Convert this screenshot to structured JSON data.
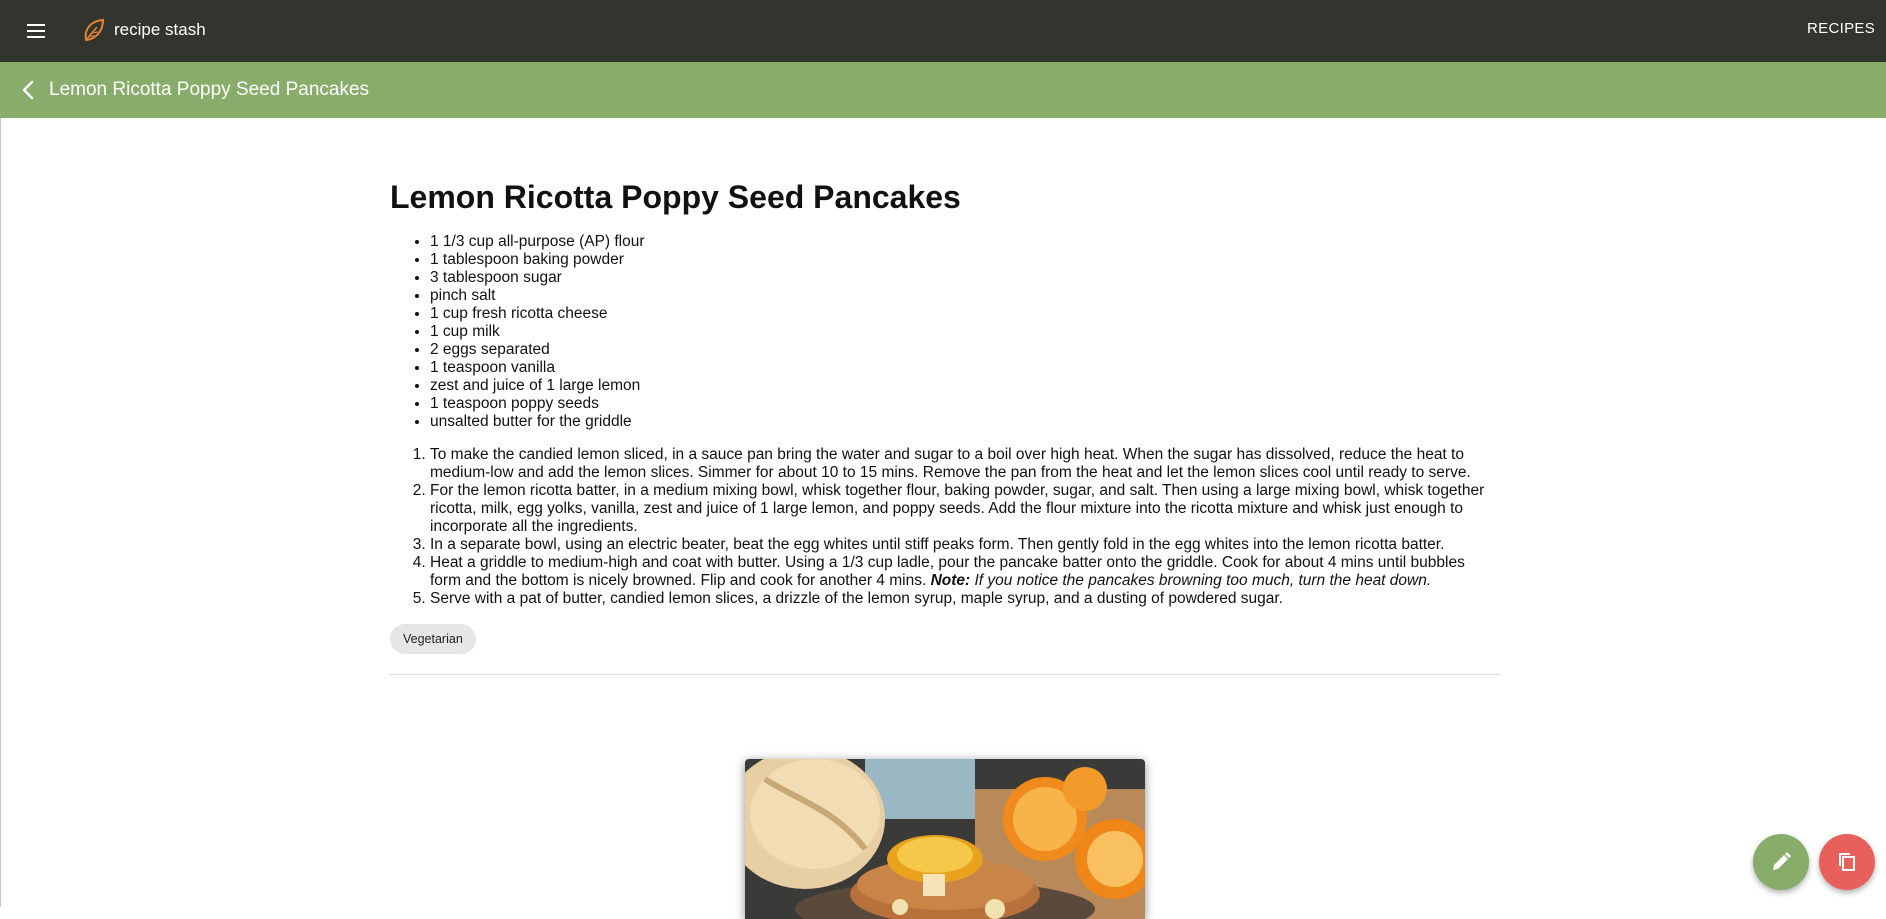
{
  "header": {
    "menu_icon": "hamburger-menu-icon",
    "logo_icon": "leaf-logo-icon",
    "brand": "recipe stash",
    "nav_link": "RECIPES"
  },
  "subheader": {
    "back_icon": "chevron-left-icon",
    "title": "Lemon Ricotta Poppy Seed Pancakes"
  },
  "recipe": {
    "title": "Lemon Ricotta Poppy Seed Pancakes",
    "ingredients": [
      "1 1/3 cup all-purpose (AP) flour",
      "1 tablespoon baking powder",
      "3 tablespoon sugar",
      "pinch salt",
      "1 cup fresh ricotta cheese",
      "1 cup milk",
      "2 eggs separated",
      "1 teaspoon vanilla",
      "zest and juice of 1 large lemon",
      "1 teaspoon poppy seeds",
      "unsalted butter for the griddle"
    ],
    "steps": [
      "To make the candied lemon sliced, in a sauce pan bring the water and sugar to a boil over high heat. When the sugar has dissolved, reduce the heat to medium-low and add the lemon slices. Simmer for about 10 to 15 mins. Remove the pan from the heat and let the lemon slices cool until ready to serve.",
      "For the lemon ricotta batter, in a medium mixing bowl, whisk together flour, baking powder, sugar, and salt. Then using a large mixing bowl, whisk together ricotta, milk, egg yolks, vanilla, zest and juice of 1 large lemon, and poppy seeds. Add the flour mixture into the ricotta mixture and whisk just enough to incorporate all the ingredients.",
      "In a separate bowl, using an electric beater, beat the egg whites until stiff peaks form. Then gently fold in the egg whites into the lemon ricotta batter.",
      "Heat a griddle to medium-high and coat with butter. Using a 1/3 cup ladle, pour the pancake batter onto the griddle. Cook for about 4 mins until bubbles form and the bottom is nicely browned. Flip and cook for another 4 mins.",
      "Serve with a pat of butter, candied lemon slices, a drizzle of the lemon syrup, maple syrup, and a dusting of powdered sugar."
    ],
    "step4_note_label": "Note:",
    "step4_note_text": "If you notice the pancakes browning too much, turn the heat down.",
    "tags": [
      "Vegetarian"
    ],
    "photo_icon": "pancake-photo"
  },
  "actions": {
    "edit_icon": "pencil-icon",
    "copy_icon": "copy-icon"
  },
  "colors": {
    "topbar": "#34342f",
    "subbar": "#88ad6a",
    "fab_edit": "#88ad6a",
    "fab_copy": "#e8605c",
    "logo_accent": "#e0843a"
  }
}
